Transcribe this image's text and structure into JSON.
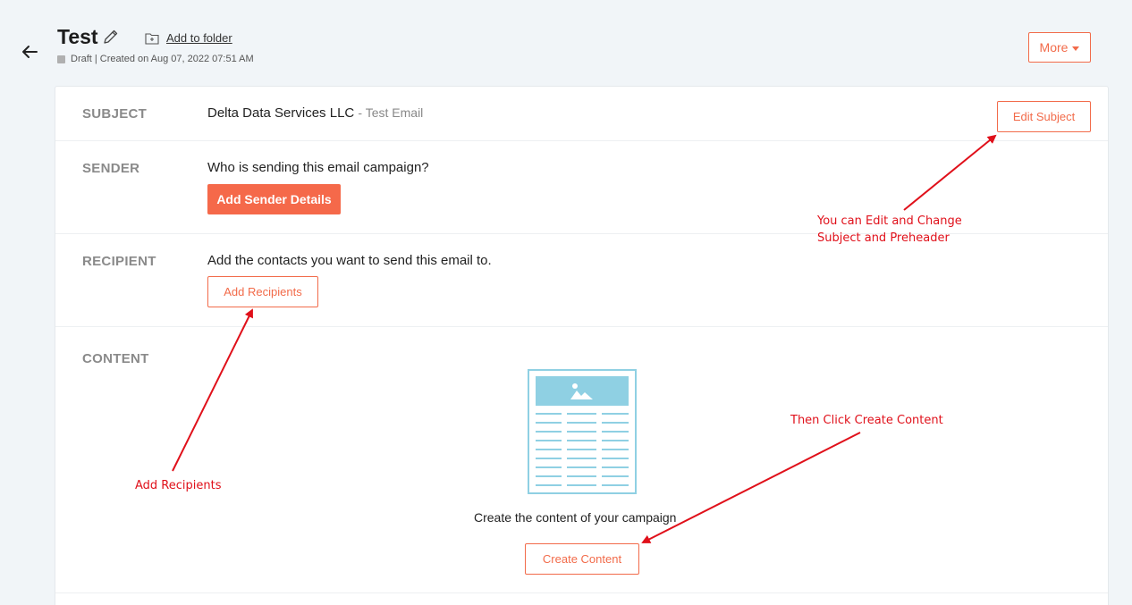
{
  "header": {
    "title": "Test",
    "add_to_folder": "Add to folder",
    "status": "Draft | Created on Aug 07, 2022 07:51 AM",
    "more_label": "More"
  },
  "subject": {
    "label": "SUBJECT",
    "value": "Delta Data Services LLC",
    "suffix": "- Test Email",
    "edit_button": "Edit Subject"
  },
  "sender": {
    "label": "SENDER",
    "prompt": "Who is sending this email campaign?",
    "button": "Add Sender Details"
  },
  "recipient": {
    "label": "RECIPIENT",
    "prompt": "Add the contacts you want to send this email to.",
    "button": "Add Recipients"
  },
  "content": {
    "label": "CONTENT",
    "caption": "Create the content of your campaign",
    "button": "Create Content"
  },
  "annotations": {
    "edit_subject_line1": "You can Edit and Change",
    "edit_subject_line2": "Subject and Preheader",
    "add_recipients": "Add Recipients",
    "create_content": "Then Click Create Content"
  },
  "colors": {
    "accent": "#f26b4a",
    "annotation": "#e0101a",
    "illustration": "#8fd0e3"
  },
  "icons": [
    "back-arrow-icon",
    "pencil-icon",
    "folder-add-icon",
    "caret-down-icon",
    "newsletter-template-icon"
  ]
}
